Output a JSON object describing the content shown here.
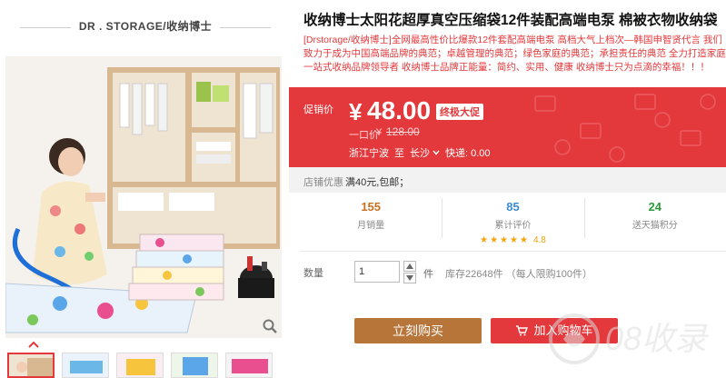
{
  "gallery": {
    "brand": "DR . STORAGE/收纳博士",
    "thumbnail_count": 5,
    "colors": {
      "frame": "#d4b48a",
      "accent": "#e4393c"
    },
    "icons": [
      "zoom-icon",
      "chevron-up-icon"
    ]
  },
  "product": {
    "title": "收纳博士太阳花超厚真空压缩袋12件装配高端电泵 棉被衣物收纳袋",
    "subtitle": "[Drstorage/收纳博士]全网最高性价比爆款12件套配高端电泵 高档大气上档次—韩国申智贤代言 我们致力于成为中国高端品牌的典范；卓越管理的典范；绿色家庭的典范；承担责任的典范 全力打造家庭一站式收纳品牌领导者 收纳博士品牌正能量：简约、实用、健康 收纳博士只为点滴的幸福！！！"
  },
  "price": {
    "label": "促销价",
    "currency": "¥",
    "value": "48.00",
    "badge": "终极大促",
    "original_label": "一口价",
    "original_currency": "¥",
    "original_value": "128.00",
    "ship_from": "浙江宁波",
    "ship_to_word": "至",
    "ship_to": "长沙",
    "shipping": "快递: 0.00",
    "color": "#e4393c"
  },
  "shop": {
    "label": "店铺优惠",
    "value": "满40元,包邮；"
  },
  "stats": {
    "sales_count": "155",
    "sales_label": "月销量",
    "reviews_count": "85",
    "reviews_label": "累计评价",
    "rating": "4.8",
    "rating_stars": 5,
    "points_count": "24",
    "points_label": "送天猫积分"
  },
  "quantity": {
    "label": "数量",
    "value": "1",
    "unit": "件",
    "stock": "库存22648件 （每人限购100件）"
  },
  "buttons": {
    "buy": "立刻购买",
    "cart": "加入购物车",
    "buy_color": "#b8753a",
    "cart_color": "#e4393c"
  },
  "watermark": {
    "text": "08收录"
  }
}
